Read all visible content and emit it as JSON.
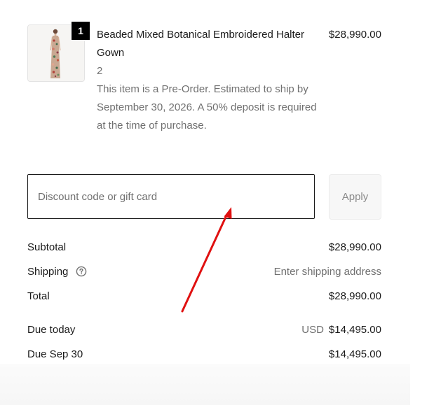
{
  "line_item": {
    "quantity": "1",
    "title": "Beaded Mixed Botanical Embroidered Halter Gown",
    "variant": "2",
    "note": "This item is a Pre-Order. Estimated to ship by September 30, 2026. A 50% deposit is required at the time of purchase.",
    "price": "$28,990.00"
  },
  "discount": {
    "placeholder": "Discount code or gift card",
    "value": "",
    "apply_label": "Apply"
  },
  "summary": {
    "subtotal_label": "Subtotal",
    "subtotal_value": "$28,990.00",
    "shipping_label": "Shipping",
    "shipping_value": "Enter shipping address",
    "total_label": "Total",
    "total_value": "$28,990.00",
    "due_today_label": "Due today",
    "due_today_currency": "USD",
    "due_today_value": "$14,495.00",
    "due_later_label": "Due Sep 30",
    "due_later_value": "$14,495.00"
  },
  "colors": {
    "annotation_arrow": "#e01010",
    "badge_bg": "#000000",
    "text_primary": "#1a1a1a",
    "text_muted": "#707070"
  },
  "icons": {
    "shipping_help": "question-circle-icon"
  }
}
